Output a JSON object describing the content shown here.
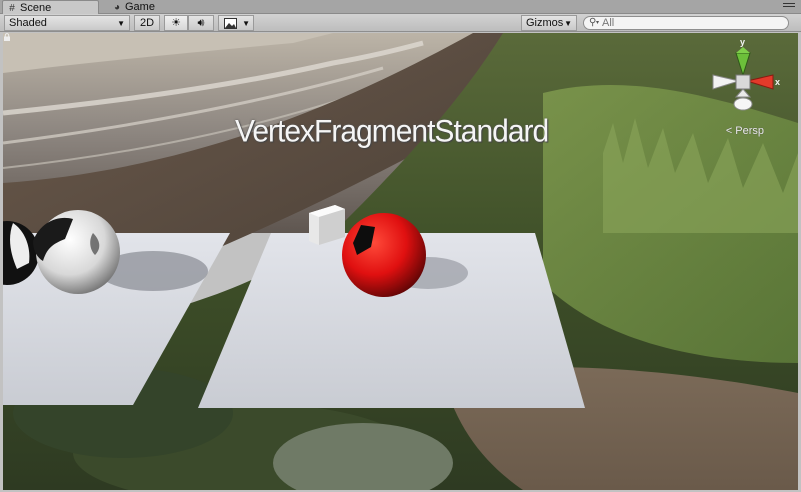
{
  "tabs": [
    {
      "label": "Scene",
      "icon": "scene-icon",
      "active": true
    },
    {
      "label": "Game",
      "icon": "game-icon",
      "active": false
    }
  ],
  "toolbar": {
    "shading_mode": "Shaded",
    "mode_2d": "2D",
    "lighting_icon": "sun-icon",
    "audio_icon": "speaker-icon",
    "effects_icon": "image-icon",
    "gizmos": "Gizmos",
    "search_placeholder": "All"
  },
  "viewport": {
    "text_label": "VertexFragmentStandard",
    "projection": "Persp",
    "axis_y": "y",
    "axis_x": "x",
    "colors": {
      "sphere_red": "#e01010",
      "sphere_white": "#e8e8e8",
      "plane": "#d0d2d8",
      "gizmo_x": "#e33a2a",
      "gizmo_y": "#6cc03a"
    }
  }
}
